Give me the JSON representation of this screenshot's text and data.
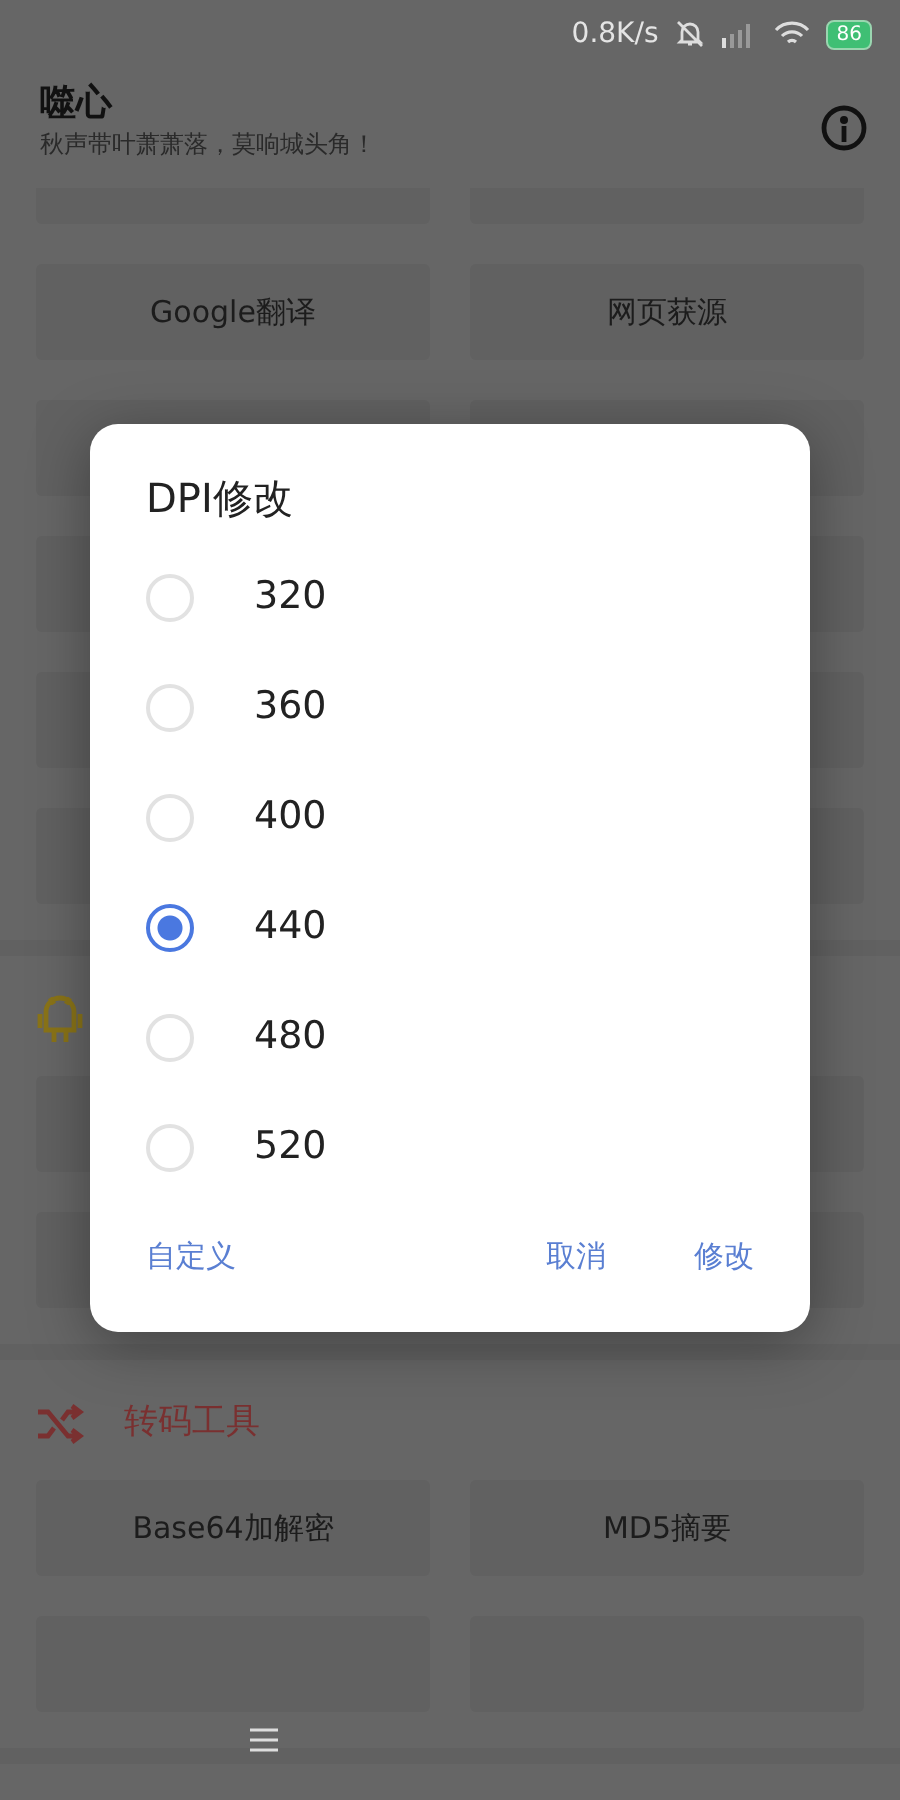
{
  "status_bar": {
    "net_speed": "0.8K/s",
    "battery": "86"
  },
  "app_bar": {
    "title": "噬心",
    "subtitle": "秋声带叶萧萧落，莫响城头角！"
  },
  "sections": [
    {
      "kind": "plain",
      "cards": [
        {
          "kind": "cut"
        },
        {
          "kind": "cut"
        },
        {
          "kind": "labeled",
          "label": "Google翻译"
        },
        {
          "kind": "labeled",
          "label": "网页获源"
        },
        {
          "kind": "blank"
        },
        {
          "kind": "blank"
        },
        {
          "kind": "blank"
        },
        {
          "kind": "blank"
        },
        {
          "kind": "blank"
        },
        {
          "kind": "blank"
        },
        {
          "kind": "blank"
        },
        {
          "kind": "blank"
        }
      ]
    },
    {
      "kind": "android",
      "cards": [
        {
          "kind": "blank"
        },
        {
          "kind": "blank"
        },
        {
          "kind": "blank"
        },
        {
          "kind": "blank"
        }
      ]
    },
    {
      "kind": "shuffle",
      "title": "转码工具",
      "cards": [
        {
          "kind": "labeled",
          "label": "Base64加解密"
        },
        {
          "kind": "labeled",
          "label": "MD5摘要"
        },
        {
          "kind": "blank"
        },
        {
          "kind": "blank"
        }
      ]
    }
  ],
  "dialog": {
    "title": "DPI修改",
    "options": [
      {
        "label": "320",
        "selected": false
      },
      {
        "label": "360",
        "selected": false
      },
      {
        "label": "400",
        "selected": false
      },
      {
        "label": "440",
        "selected": true
      },
      {
        "label": "480",
        "selected": false
      },
      {
        "label": "520",
        "selected": false
      }
    ],
    "buttons": [
      {
        "kind": "left",
        "label": "自定义"
      },
      {
        "kind": "right",
        "label": "取消"
      },
      {
        "kind": "right",
        "label": "修改"
      }
    ]
  }
}
